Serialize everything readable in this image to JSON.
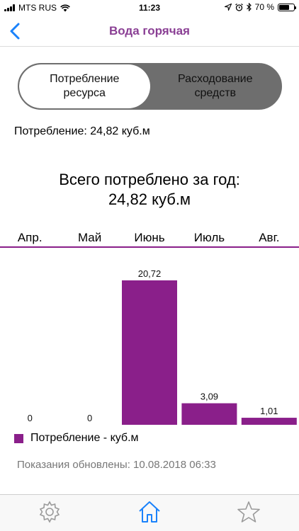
{
  "status_bar": {
    "carrier": "MTS RUS",
    "time": "11:23",
    "battery": "70 %"
  },
  "nav": {
    "title": "Вода горячая"
  },
  "segment": {
    "left": "Потребление\nресурса",
    "right": "Расходование\nсредств",
    "selected": "left"
  },
  "consumption_line": "Потребление: 24,82 куб.м",
  "total": {
    "line1": "Всего потреблено за год:",
    "line2": "24,82 куб.м"
  },
  "chart_data": {
    "type": "bar",
    "categories": [
      "Апр.",
      "Май",
      "Июнь",
      "Июль",
      "Авг."
    ],
    "values": [
      0,
      0,
      20.72,
      3.09,
      1.01
    ],
    "value_labels": [
      "0",
      "0",
      "20,72",
      "3,09",
      "1,01"
    ],
    "series": [
      {
        "name": "Потребление - куб.м",
        "values": [
          0,
          0,
          20.72,
          3.09,
          1.01
        ]
      }
    ],
    "ylim": [
      0,
      20.72
    ],
    "grid": false,
    "legend": "bottom-left",
    "color": "#8a1f8a"
  },
  "legend_label": "Потребление - куб.м",
  "updated": "Показания обновлены: 10.08.2018 06:33",
  "tabs": [
    {
      "name": "settings",
      "icon": "gear-icon"
    },
    {
      "name": "home",
      "icon": "home-icon",
      "active": true
    },
    {
      "name": "favorites",
      "icon": "star-icon"
    }
  ],
  "colors": {
    "accent": "#8a1f8a",
    "title": "#8a3f94",
    "ios_blue": "#1a82fb"
  }
}
